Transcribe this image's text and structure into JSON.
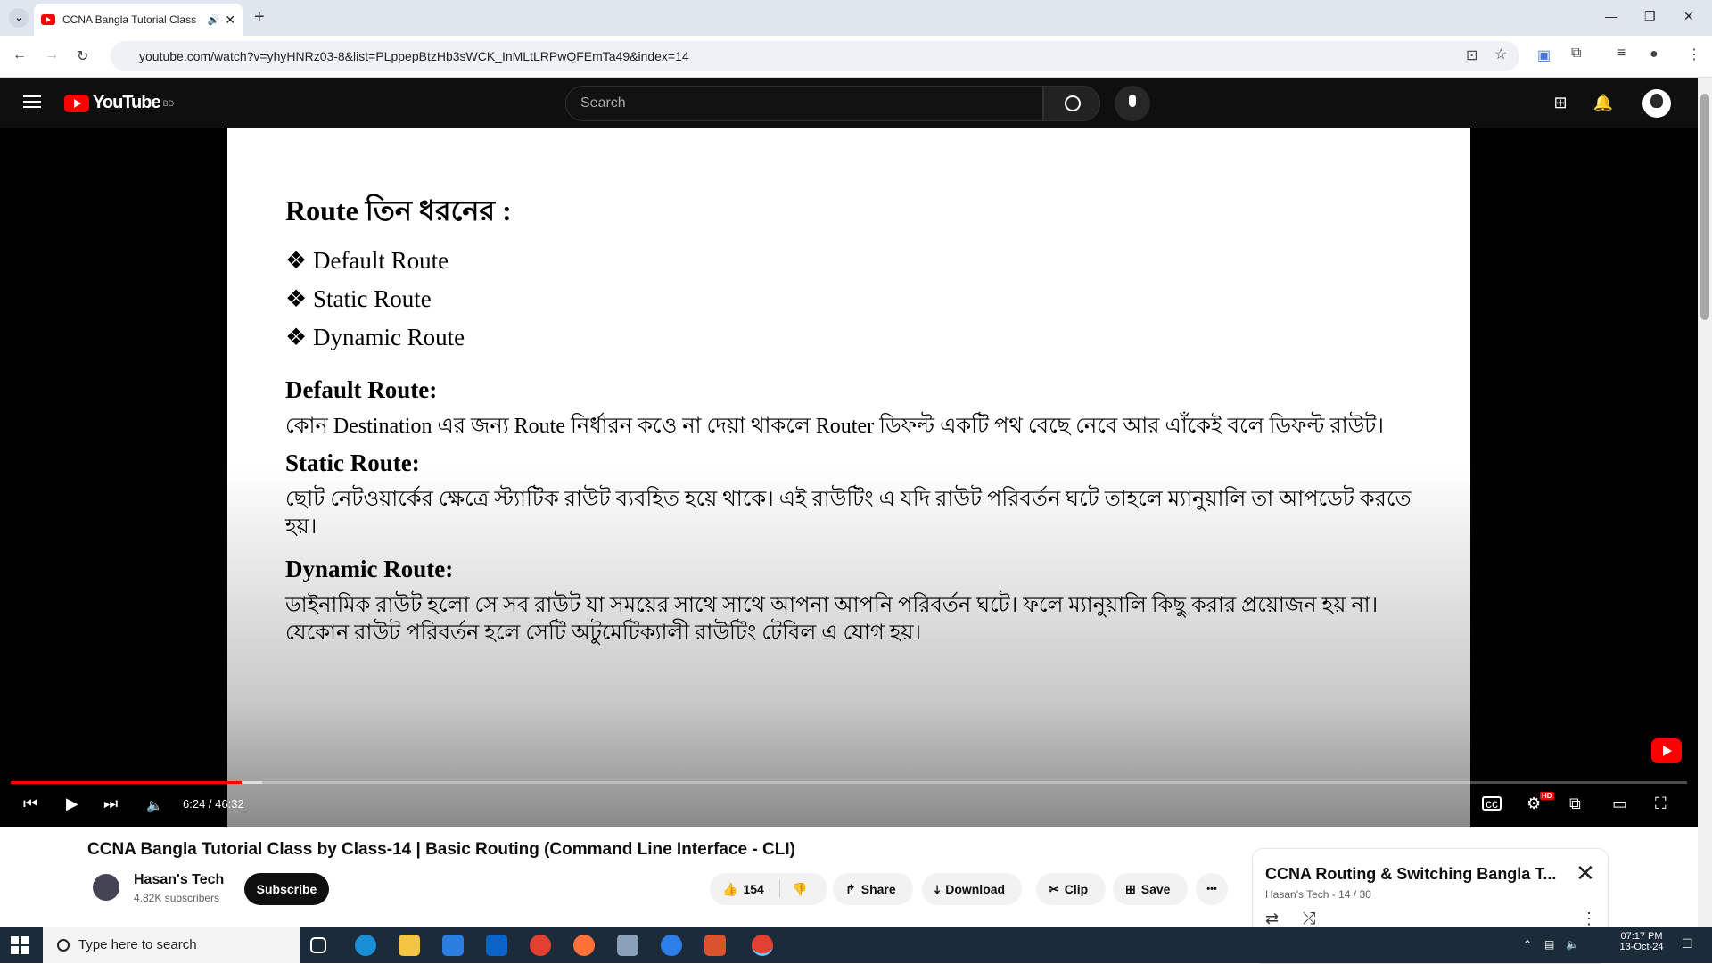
{
  "browser": {
    "tab_title": "CCNA Bangla Tutorial Class",
    "tab_audio": "🔊",
    "close_glyph": "✕",
    "new_tab_glyph": "+",
    "url": "youtube.com/watch?v=yhyHNRz03-8&list=PLppepBtzHb3sWCK_InMLtLRPwQFEmTa49&index=14"
  },
  "youtube": {
    "logo_text": "YouTube",
    "country": "BD",
    "search_placeholder": "Search"
  },
  "slide": {
    "heading": "Route তিন ধরনের :",
    "bullets": [
      "❖ Default Route",
      "❖ Static Route",
      "❖ Dynamic Route"
    ],
    "sections": [
      {
        "title": "Default Route:",
        "text": "কোন Destination এর জন্য Route নির্ধারন কওে না দেয়া থাকলে Router ডিফল্ট একটি পথ বেছে নেবে আর এাঁকেই বলে ডিফল্ট রাউট।"
      },
      {
        "title": "Static Route:",
        "text": "ছোট নেটওয়ার্কের ক্ষেত্রে স্ট্যাটিক রাউট ব্যবহিত হয়ে থাকে। এই রাউটিং এ যদি রাউট পরিবর্তন ঘটে তাহলে ম্যানুয়ালি তা আপডেট করতে হয়।"
      },
      {
        "title": "Dynamic Route:",
        "text": "ডাইনামিক রাউট হলো সে সব রাউট যা সময়ের সাথে সাথে আপনা আপনি পরিবর্তন ঘটে। ফলে ম্যানুয়ালি কিছু করার প্রয়োজন হয় না। যেকোন রাউট পরিবর্তন হলে সেটি অটুমেটিক্যালী রাউটিং টেবিল এ যোগ হয়।"
      }
    ]
  },
  "player": {
    "time": "6:24 / 46:32",
    "progress_fraction": 0.1375,
    "buffered_fraction": 0.15,
    "hd_badge": "HD"
  },
  "video": {
    "title": "CCNA Bangla Tutorial Class by Class-14 | Basic Routing (Command Line Interface - CLI)",
    "channel": "Hasan's Tech",
    "subscribers": "4.82K subscribers",
    "subscribe_label": "Subscribe",
    "likes": "154",
    "share_label": "Share",
    "download_label": "Download",
    "clip_label": "Clip",
    "save_label": "Save",
    "more_label": "•••"
  },
  "playlist": {
    "title": "CCNA Routing & Switching Bangla T...",
    "subtitle": "Hasan's Tech - 14 / 30"
  },
  "taskbar": {
    "search_placeholder": "Type here to search",
    "time": "07:17 PM",
    "date": "13-Oct-24"
  },
  "colors": {
    "accent": "#ff0000",
    "yt_dark": "#0f0f0f",
    "taskbar": "#1c2b3a"
  }
}
